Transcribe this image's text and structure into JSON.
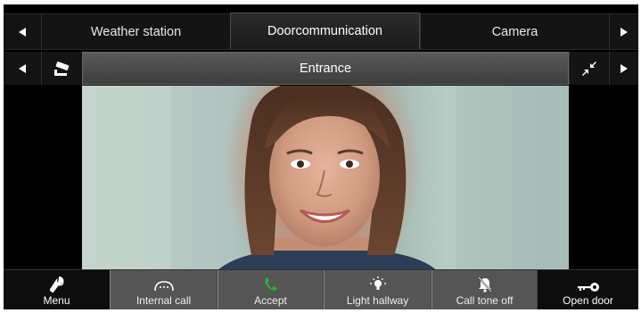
{
  "tabs_bar": {
    "tabs": [
      {
        "label": "Weather station",
        "active": false
      },
      {
        "label": "Doorcommunication",
        "active": true
      },
      {
        "label": "Camera",
        "active": false
      }
    ]
  },
  "camera_bar": {
    "title": "Entrance"
  },
  "bottom_bar": {
    "buttons": [
      {
        "label": "Menu",
        "icon": "wrench-icon"
      },
      {
        "label": "Internal call",
        "icon": "intercom-handset-icon"
      },
      {
        "label": "Accept",
        "icon": "phone-accept-icon"
      },
      {
        "label": "Light hallway",
        "icon": "light-bulb-icon"
      },
      {
        "label": "Call tone off",
        "icon": "bell-off-icon"
      },
      {
        "label": "Open door",
        "icon": "key-icon"
      }
    ]
  },
  "colors": {
    "accept_green": "#2fae3a",
    "background": "#000000"
  }
}
